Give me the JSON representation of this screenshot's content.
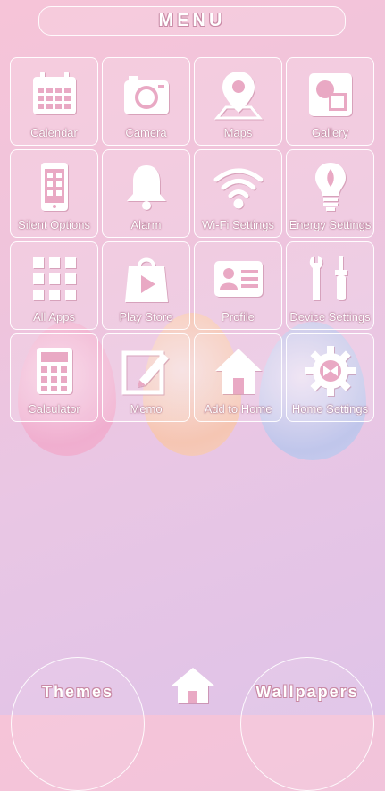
{
  "menu": {
    "title": "MENU"
  },
  "grid": {
    "tiles": [
      {
        "label": "Calendar",
        "icon": "calendar-icon"
      },
      {
        "label": "Camera",
        "icon": "camera-icon"
      },
      {
        "label": "Maps",
        "icon": "map-pin-icon"
      },
      {
        "label": "Gallery",
        "icon": "gallery-icon"
      },
      {
        "label": "Silent Options",
        "icon": "phone-icon"
      },
      {
        "label": "Alarm",
        "icon": "bell-icon"
      },
      {
        "label": "Wi-Fi Settings",
        "icon": "wifi-icon"
      },
      {
        "label": "Energy Settings",
        "icon": "lightbulb-icon"
      },
      {
        "label": "All Apps",
        "icon": "apps-grid-icon"
      },
      {
        "label": "Play Store",
        "icon": "play-store-bag-icon"
      },
      {
        "label": "Profile",
        "icon": "profile-card-icon"
      },
      {
        "label": "Device Settings",
        "icon": "tools-icon"
      },
      {
        "label": "Calculator",
        "icon": "calculator-icon"
      },
      {
        "label": "Memo",
        "icon": "memo-pencil-icon"
      },
      {
        "label": "Add to Home",
        "icon": "house-icon"
      },
      {
        "label": "Home Settings",
        "icon": "gear-icon"
      }
    ]
  },
  "bottom": {
    "themes_label": "Themes",
    "wallpapers_label": "Wallpapers",
    "home_icon": "house-icon"
  },
  "colors": {
    "icon": "#ffffff",
    "text_outline": "#c98aa6"
  }
}
